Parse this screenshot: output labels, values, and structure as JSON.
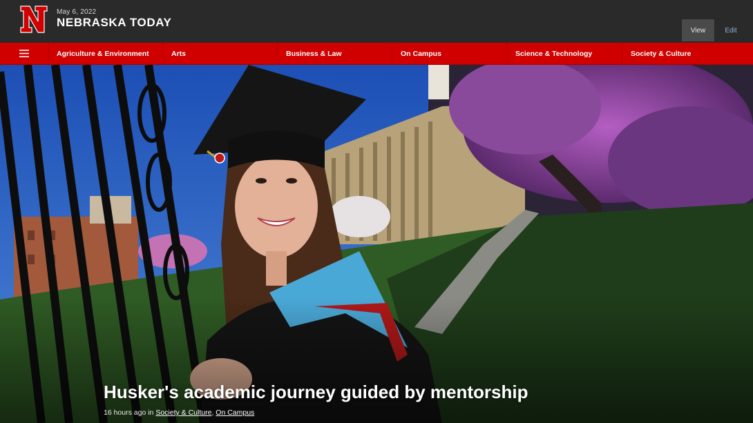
{
  "header": {
    "date": "May 6, 2022",
    "site_title": "NEBRASKA TODAY",
    "logo_letter": "N",
    "view_label": "View",
    "edit_label": "Edit"
  },
  "nav": {
    "menu_icon": "hamburger-icon",
    "items": [
      {
        "label": "Agriculture & Environment"
      },
      {
        "label": "Arts"
      },
      {
        "label": "Business & Law"
      },
      {
        "label": "On Campus"
      },
      {
        "label": "Science & Technology"
      },
      {
        "label": "Society & Culture"
      }
    ]
  },
  "article": {
    "headline": "Husker's academic journey guided by mentorship",
    "posted": "16 hours ago in",
    "categories": [
      "Society & Culture",
      "On Campus"
    ],
    "separator": ","
  },
  "colors": {
    "brand_red": "#d00000",
    "header_dark": "#2a2a2a"
  }
}
